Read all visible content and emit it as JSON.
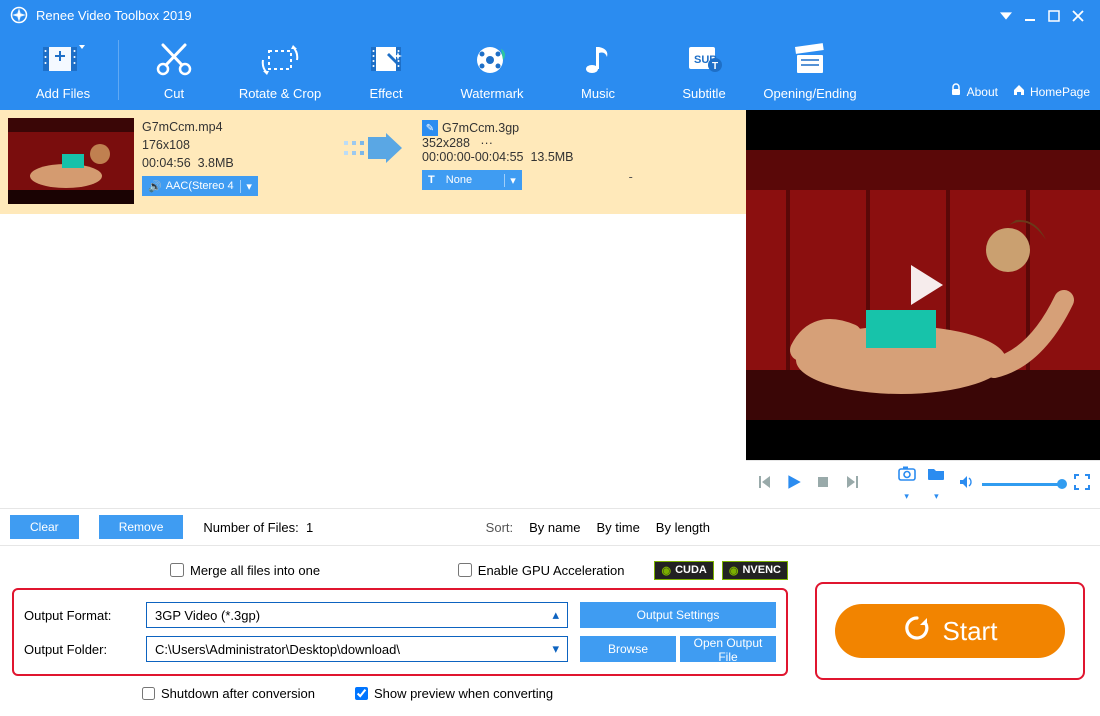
{
  "title": "Renee Video Toolbox 2019",
  "toolbar": {
    "add_files": "Add Files",
    "cut": "Cut",
    "rotate_crop": "Rotate & Crop",
    "effect": "Effect",
    "watermark": "Watermark",
    "music": "Music",
    "subtitle": "Subtitle",
    "opening_ending": "Opening/Ending",
    "about": "About",
    "homepage": "HomePage"
  },
  "file": {
    "src_name": "G7mCcm.mp4",
    "src_res": "176x108",
    "src_dur": "00:04:56",
    "src_size": "3.8MB",
    "audio_tag": "AAC(Stereo 4",
    "subtitle_tag": "None",
    "dst_name": "G7mCcm.3gp",
    "dst_res": "352x288",
    "dst_dots": "···",
    "dst_range": "00:00:00-00:04:55",
    "dst_size": "13.5MB",
    "dash": "-"
  },
  "actions": {
    "clear": "Clear",
    "remove": "Remove",
    "count_label": "Number of Files:",
    "count_value": "1",
    "sort_label": "Sort:",
    "by_name": "By name",
    "by_time": "By time",
    "by_length": "By length"
  },
  "bottom": {
    "merge": "Merge all files into one",
    "gpu": "Enable GPU Acceleration",
    "cuda": "CUDA",
    "nvenc": "NVENC",
    "format_label": "Output Format:",
    "format_value": "3GP Video (*.3gp)",
    "folder_label": "Output Folder:",
    "folder_value": "C:\\Users\\Administrator\\Desktop\\download\\",
    "output_settings": "Output Settings",
    "browse": "Browse",
    "open_output": "Open Output File",
    "shutdown": "Shutdown after conversion",
    "show_preview": "Show preview when converting",
    "start": "Start"
  }
}
